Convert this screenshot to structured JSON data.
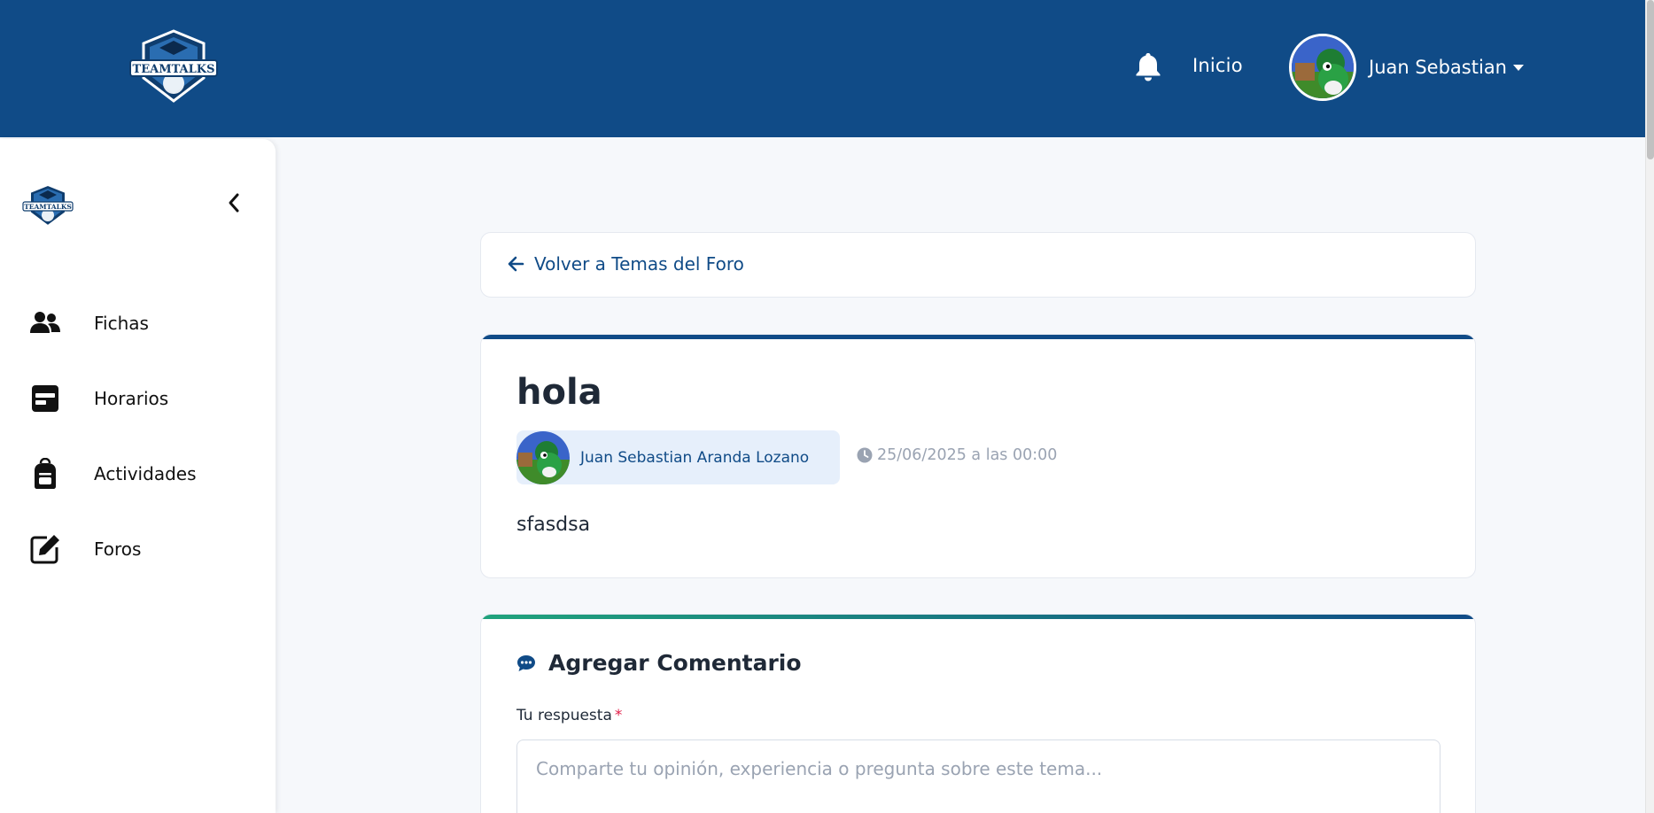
{
  "header": {
    "logo_text": "TEAMTALKS",
    "nav_home_label": "Inicio",
    "user_name": "Juan Sebastian"
  },
  "sidebar": {
    "logo_text": "TEAMTALKS",
    "items": [
      {
        "label": "Fichas",
        "icon": "users-icon"
      },
      {
        "label": "Horarios",
        "icon": "calendar-icon"
      },
      {
        "label": "Actividades",
        "icon": "backpack-icon"
      },
      {
        "label": "Foros",
        "icon": "edit-icon"
      }
    ]
  },
  "back_link": {
    "label": "Volver a Temas del Foro"
  },
  "topic": {
    "title": "hola",
    "author": "Juan Sebastian Aranda Lozano",
    "date": "25/06/2025 a las 00:00",
    "body": "sfasdsa"
  },
  "comment_form": {
    "title": "Agregar Comentario",
    "label": "Tu respuesta",
    "required_mark": "*",
    "placeholder": "Comparte tu opinión, experiencia o pregunta sobre este tema..."
  },
  "colors": {
    "primary": "#104b87",
    "accent_green": "#20a37c",
    "chip_bg": "#e6effb",
    "muted": "#9aa3b2",
    "required": "#e11d48"
  }
}
